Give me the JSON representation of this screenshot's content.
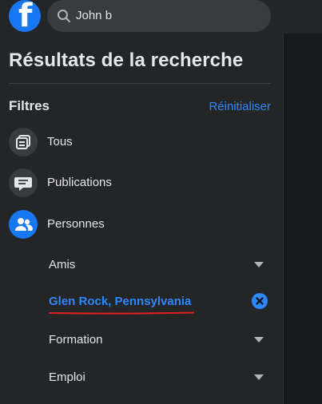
{
  "topbar": {
    "logo_letter": "f",
    "search_value": "John b"
  },
  "panel": {
    "title": "Résultats de la recherche",
    "filters_label": "Filtres",
    "reset_label": "Réinitialiser",
    "categories": [
      {
        "label": "Tous",
        "icon": "all-results-icon"
      },
      {
        "label": "Publications",
        "icon": "posts-icon"
      },
      {
        "label": "Personnes",
        "icon": "people-icon",
        "active": true
      }
    ],
    "subfilters": [
      {
        "label": "Amis",
        "icon": "chevron-down-icon"
      },
      {
        "label": "Glen Rock, Pennsylvania",
        "icon": "clear-icon",
        "selected": true
      },
      {
        "label": "Formation",
        "icon": "chevron-down-icon"
      },
      {
        "label": "Emploi",
        "icon": "chevron-down-icon"
      }
    ]
  },
  "colors": {
    "brand": "#1877f2",
    "link": "#2d88ff",
    "annotation": "#e02020"
  }
}
